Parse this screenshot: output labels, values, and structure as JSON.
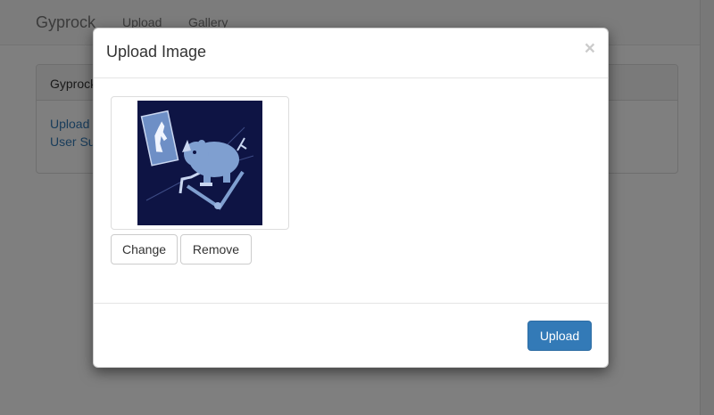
{
  "navbar": {
    "brand": "Gyprock",
    "links": [
      "Upload",
      "Gallery"
    ]
  },
  "panel": {
    "heading": "Gyprock",
    "links": [
      "Upload",
      "User Su"
    ]
  },
  "modal": {
    "title": "Upload Image",
    "close_label": "×",
    "image_icon": "rhino-treadmill-illustration",
    "change_label": "Change",
    "remove_label": "Remove",
    "upload_label": "Upload"
  },
  "colors": {
    "primary": "#337ab7",
    "image_background": "#0e1444",
    "illustration": "#7f9fd0"
  }
}
